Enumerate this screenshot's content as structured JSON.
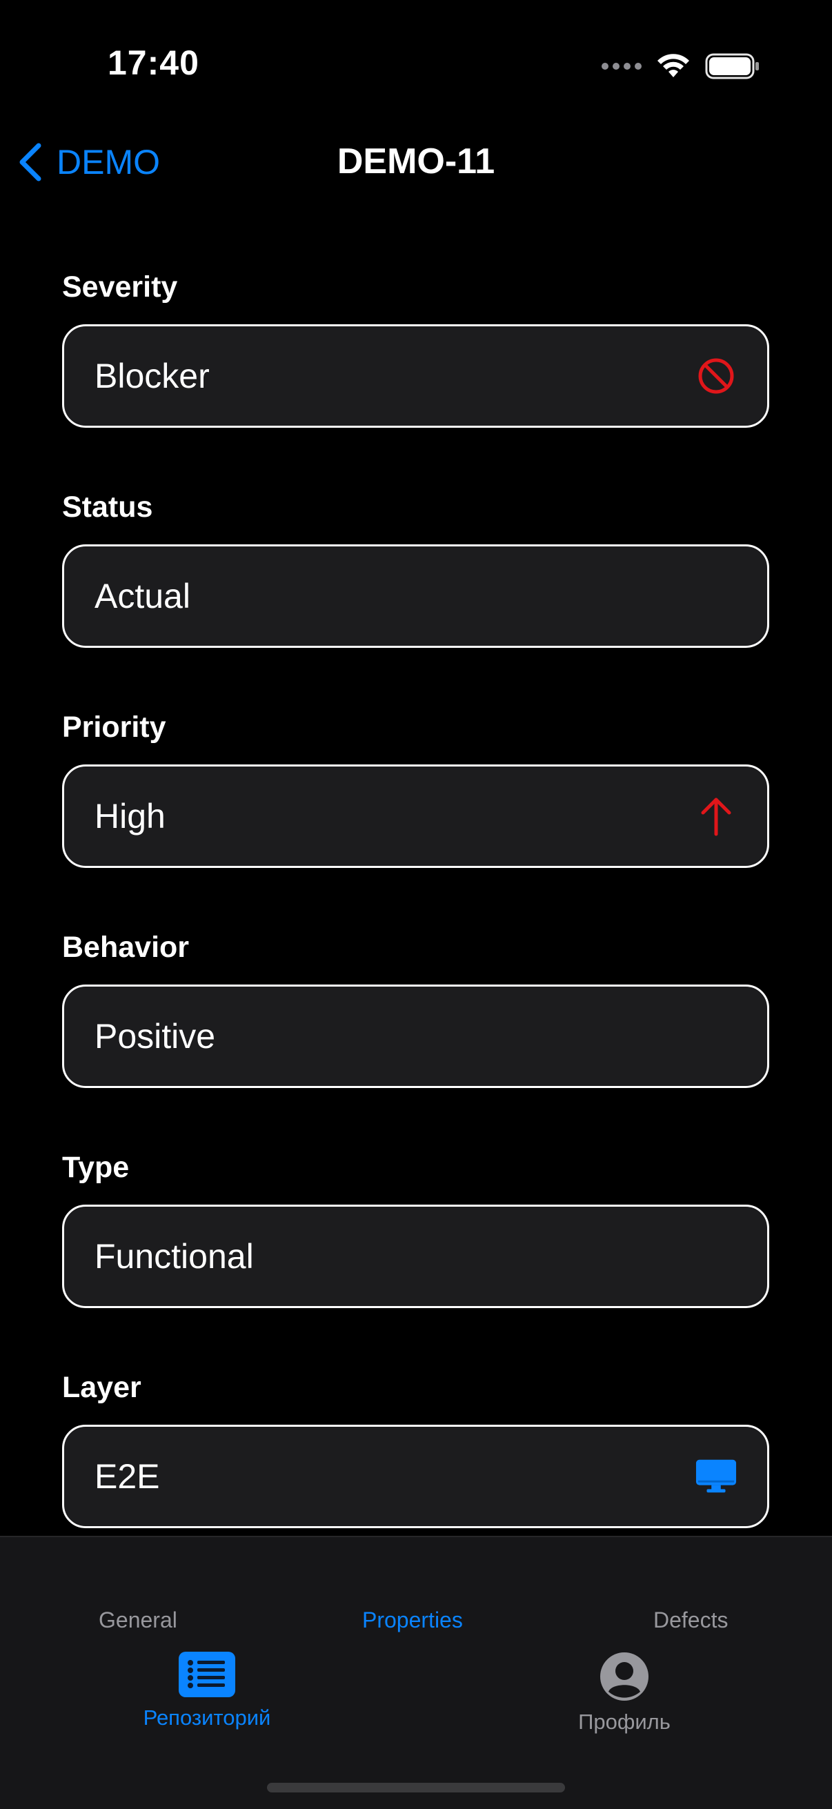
{
  "status_bar": {
    "time": "17:40"
  },
  "nav": {
    "back_label": "DEMO",
    "title": "DEMO-11"
  },
  "fields": [
    {
      "label": "Severity",
      "value": "Blocker",
      "icon": "blocker-icon",
      "icon_color": "#e0161a"
    },
    {
      "label": "Status",
      "value": "Actual",
      "icon": ""
    },
    {
      "label": "Priority",
      "value": "High",
      "icon": "arrow-up-icon",
      "icon_color": "#e0161a"
    },
    {
      "label": "Behavior",
      "value": "Positive",
      "icon": ""
    },
    {
      "label": "Type",
      "value": "Functional",
      "icon": ""
    },
    {
      "label": "Layer",
      "value": "E2E",
      "icon": "desktop-icon",
      "icon_color": "#0a84ff"
    }
  ],
  "segments": [
    {
      "label": "General",
      "active": false
    },
    {
      "label": "Properties",
      "active": true
    },
    {
      "label": "Defects",
      "active": false
    }
  ],
  "tabs": [
    {
      "label": "Репозиторий",
      "icon": "list-icon",
      "active": true
    },
    {
      "label": "Профиль",
      "icon": "profile-icon",
      "active": false
    }
  ],
  "colors": {
    "accent": "#0a84ff",
    "background": "#000000",
    "field_bg": "#1c1c1e",
    "danger": "#e0161a"
  }
}
